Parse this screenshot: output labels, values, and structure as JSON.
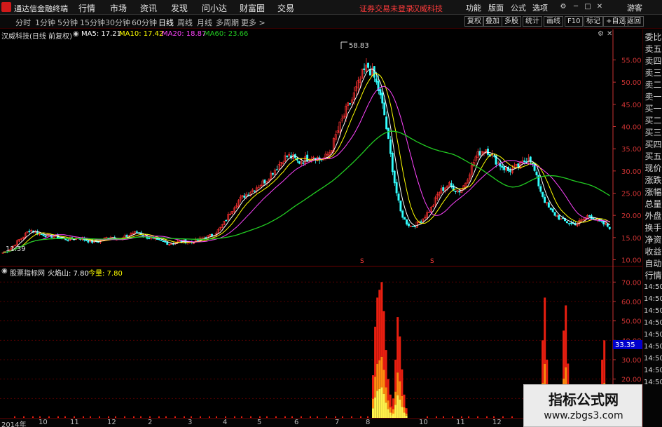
{
  "app": {
    "name": "通达信金融终端",
    "menu": [
      "行情",
      "市场",
      "资讯",
      "发现",
      "问小达",
      "财富圈",
      "交易"
    ],
    "notice": "证券交易未登录",
    "stock_title": "汉威科技",
    "right_menu": [
      "功能",
      "版面",
      "公式",
      "选项"
    ],
    "guest": "游客"
  },
  "periods": [
    "分时",
    "1分钟",
    "5分钟",
    "15分钟",
    "30分钟",
    "60分钟",
    "日线",
    "周线",
    "月线",
    "多周期",
    "更多 >"
  ],
  "active_period": "日线",
  "toolbar": [
    "复权",
    "叠加",
    "多股",
    "统计",
    "画线",
    "F10",
    "标记",
    "+自选",
    "返回"
  ],
  "main_info": {
    "title": "汉威科技(日线 前复权)",
    "ma5": "MA5: 17.21",
    "ma10": "MA10: 17.42",
    "ma20": "MA20: 18.87",
    "ma60": "MA60: 23.66"
  },
  "annotations": {
    "high": "58.83",
    "low": "11.39",
    "marker": "S"
  },
  "sub_info": {
    "name": "股票指标网",
    "huoyanshan": "火焰山: 7.80",
    "jinliang": "今量: 7.80"
  },
  "current_value_tag": "33.35",
  "side_panel": [
    "委比",
    "卖五",
    "卖四",
    "卖三",
    "卖二",
    "卖一",
    "买一",
    "买二",
    "买三",
    "买四",
    "买五",
    "现价",
    "涨跌",
    "涨幅",
    "总量",
    "外盘",
    "换手",
    "净资",
    "收益",
    "自动",
    "行情",
    "14:50",
    "14:50",
    "14:50",
    "14:50",
    "14:50",
    "14:50",
    "14:50",
    "14:50",
    "14:50"
  ],
  "time_axis": [
    "2014年",
    "10",
    "11",
    "12",
    "2",
    "3",
    "4",
    "5",
    "6",
    "7",
    "8",
    "10",
    "11",
    "12"
  ],
  "watermark": {
    "title": "指标公式网",
    "url": "www.zbgs3.com"
  },
  "colors": {
    "ma5": "#ffffff",
    "ma10": "#ffff00",
    "ma20": "#ff44ff",
    "ma60": "#22cc22",
    "up": "#ff3232",
    "down": "#33ffff",
    "axis": "#c83232",
    "grid": "#550000"
  },
  "chart_data": [
    {
      "type": "candlestick",
      "title": "汉威科技(日线 前复权)",
      "yaxis_ticks": [
        10,
        15,
        20,
        25,
        30,
        35,
        40,
        45,
        50,
        55
      ],
      "ylim": [
        8.5,
        59.5
      ],
      "high": 58.83,
      "low": 11.39,
      "close_path": [
        11.6,
        12.2,
        13.2,
        14.5,
        15.5,
        16.8,
        16.3,
        15.8,
        15.5,
        15.3,
        15.2,
        14.8,
        14.6,
        14.7,
        15.0,
        14.6,
        14.2,
        14.0,
        14.3,
        14.8,
        15.2,
        15.0,
        14.6,
        15.3,
        16.0,
        16.2,
        15.6,
        15.0,
        14.6,
        14.3,
        14.0,
        13.6,
        13.9,
        14.2,
        14.1,
        13.9,
        14.3,
        14.8,
        15.2,
        15.6,
        16.5,
        18.0,
        20.0,
        22.0,
        23.5,
        24.5,
        25.3,
        26.2,
        27.0,
        28.0,
        29.5,
        30.8,
        32.5,
        33.5,
        33.0,
        32.0,
        32.5,
        33.0,
        33.5,
        32.5,
        33.0,
        34.5,
        38.0,
        41.0,
        44.0,
        46.0,
        49.0,
        52.0,
        53.5,
        51.5,
        48.0,
        43.0,
        35.0,
        27.0,
        21.0,
        18.5,
        17.5,
        18.0,
        19.0,
        20.5,
        22.0,
        25.0,
        26.0,
        27.0,
        26.0,
        25.5,
        27.0,
        30.0,
        33.0,
        34.5,
        35.0,
        33.5,
        32.0,
        31.0,
        30.0,
        30.5,
        31.0,
        32.0,
        33.5,
        30.0,
        26.0,
        23.0,
        21.0,
        20.0,
        19.0,
        18.5,
        18.0,
        18.3,
        19.0,
        20.0,
        19.5,
        18.5,
        18.0,
        17.3
      ],
      "ma": [
        {
          "name": "MA5",
          "last": 17.21
        },
        {
          "name": "MA10",
          "last": 17.42
        },
        {
          "name": "MA20",
          "last": 18.87
        },
        {
          "name": "MA60",
          "last": 23.66
        }
      ]
    },
    {
      "type": "bar",
      "title": "火焰山",
      "yaxis_ticks": [
        10,
        20,
        30,
        40,
        50,
        60,
        70
      ],
      "ylim": [
        0,
        73
      ],
      "current": 7.8,
      "spikes": [
        {
          "period": "7-8",
          "values": [
            22,
            47,
            62,
            66,
            70,
            55,
            35,
            20,
            12,
            6,
            3
          ]
        },
        {
          "period": "8",
          "values": [
            10,
            30,
            52,
            42,
            25,
            12,
            5
          ]
        },
        {
          "period": "11-12a",
          "values": [
            12,
            40,
            62,
            30,
            8
          ]
        },
        {
          "period": "11-12b",
          "values": [
            14,
            45,
            58,
            28,
            8
          ]
        },
        {
          "period": "12",
          "values": [
            8,
            30,
            40,
            15
          ]
        }
      ]
    }
  ]
}
